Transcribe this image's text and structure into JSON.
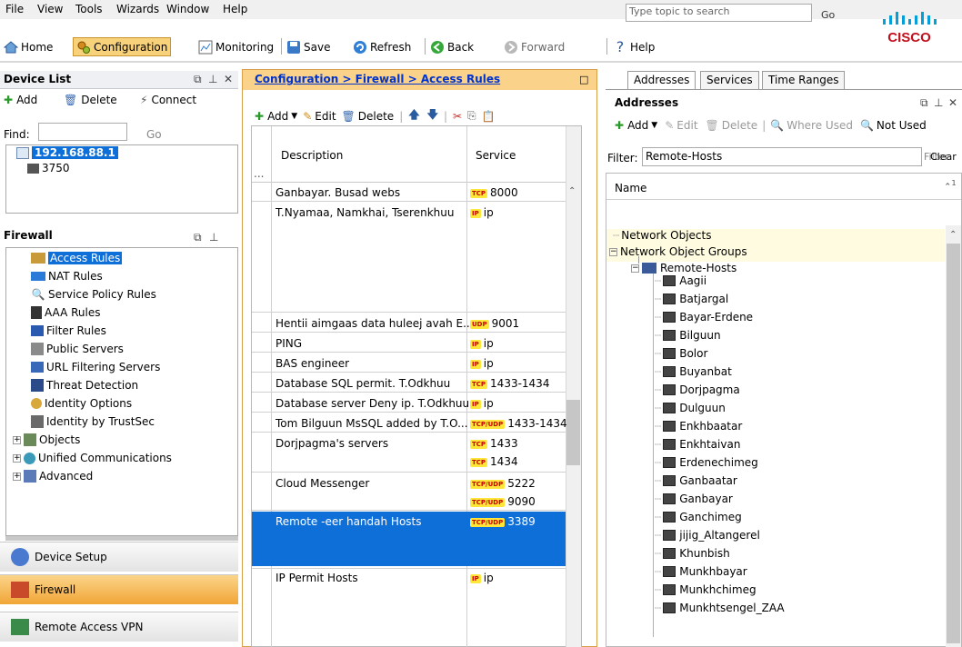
{
  "menu": {
    "items": [
      "File",
      "View",
      "Tools",
      "Wizards",
      "Window",
      "Help"
    ]
  },
  "top_search": {
    "placeholder": "Type topic to search",
    "go": "Go"
  },
  "toolbar": {
    "home": "Home",
    "configuration": "Configuration",
    "monitoring": "Monitoring",
    "save": "Save",
    "refresh": "Refresh",
    "back": "Back",
    "forward": "Forward",
    "help": "Help"
  },
  "device_list": {
    "title": "Device List",
    "add": "Add",
    "delete": "Delete",
    "connect": "Connect",
    "find_label": "Find:",
    "go": "Go",
    "devices": [
      "192.168.88.1",
      "3750"
    ]
  },
  "firewall": {
    "title": "Firewall",
    "items": [
      "Access Rules",
      "NAT Rules",
      "Service Policy Rules",
      "AAA Rules",
      "Filter Rules",
      "Public Servers",
      "URL Filtering Servers",
      "Threat Detection",
      "Identity Options",
      "Identity by TrustSec",
      "Objects",
      "Unified Communications",
      "Advanced"
    ]
  },
  "nav_buttons": [
    "Device Setup",
    "Firewall",
    "Remote Access VPN"
  ],
  "center": {
    "breadcrumb": "Configuration > Firewall > Access Rules",
    "add": "Add",
    "edit": "Edit",
    "delete": "Delete",
    "col_description": "Description",
    "col_service": "Service",
    "col_more": "...",
    "rows": [
      {
        "desc": "Ganbayar. Busad webs",
        "services": [
          {
            "badge": "TCP",
            "val": "8000"
          }
        ]
      },
      {
        "desc": "T.Nyamaa, Namkhai, Tserenkhuu",
        "services": [
          {
            "badge": "IP",
            "val": "ip"
          }
        ]
      },
      {
        "desc": "Hentii aimgaas data huleej avah E...",
        "services": [
          {
            "badge": "UDP",
            "val": "9001"
          }
        ]
      },
      {
        "desc": "PING",
        "services": [
          {
            "badge": "IP",
            "val": "ip"
          }
        ]
      },
      {
        "desc": "BAS engineer",
        "services": [
          {
            "badge": "IP",
            "val": "ip"
          }
        ]
      },
      {
        "desc": "Database SQL permit. T.Odkhuu",
        "services": [
          {
            "badge": "TCP",
            "val": "1433-1434"
          }
        ]
      },
      {
        "desc": "Database server Deny ip. T.Odkhuu",
        "services": [
          {
            "badge": "IP",
            "val": "ip"
          }
        ]
      },
      {
        "desc": "Tom Bilguun MsSQL added by T.O...",
        "services": [
          {
            "badge": "TCP/UDP",
            "val": "1433-1434"
          }
        ]
      },
      {
        "desc": "Dorjpagma's servers",
        "services": [
          {
            "badge": "TCP",
            "val": "1433"
          },
          {
            "badge": "TCP",
            "val": "1434"
          }
        ]
      },
      {
        "desc": "Cloud Messenger",
        "services": [
          {
            "badge": "TCP/UDP",
            "val": "5222"
          },
          {
            "badge": "TCP/UDP",
            "val": "9090"
          }
        ]
      },
      {
        "desc": "Remote -eer handah Hosts",
        "services": [
          {
            "badge": "TCP/UDP",
            "val": "3389"
          }
        ]
      },
      {
        "desc": "IP Permit Hosts",
        "services": [
          {
            "badge": "IP",
            "val": "ip"
          }
        ]
      }
    ]
  },
  "right": {
    "tabs": [
      "Addresses",
      "Services",
      "Time Ranges"
    ],
    "title": "Addresses",
    "add": "Add",
    "edit": "Edit",
    "delete": "Delete",
    "where_used": "Where Used",
    "not_used": "Not Used",
    "filter_label": "Filter:",
    "filter_value": "Remote-Hosts",
    "filter_btn": "Filter",
    "clear_btn": "Clear",
    "col_name": "Name",
    "sort_marker": "1",
    "tree_root1": "Network Objects",
    "tree_root2": "Network Object Groups",
    "group": "Remote-Hosts",
    "hosts": [
      "Aagii",
      "Batjargal",
      "Bayar-Erdene",
      "Bilguun",
      "Bolor",
      "Buyanbat",
      "Dorjpagma",
      "Dulguun",
      "Enkhbaatar",
      "Enkhtaivan",
      "Erdenechimeg",
      "Ganbaatar",
      "Ganbayar",
      "Ganchimeg",
      "jijig_Altangerel",
      "Khunbish",
      "Munkhbayar",
      "Munkhchimeg",
      "Munkhtsengel_ZAA"
    ]
  },
  "colors": {
    "accent": "#f0a236",
    "selection": "#0f6fd8",
    "link": "#0033cc",
    "brand": "#049fd9"
  }
}
